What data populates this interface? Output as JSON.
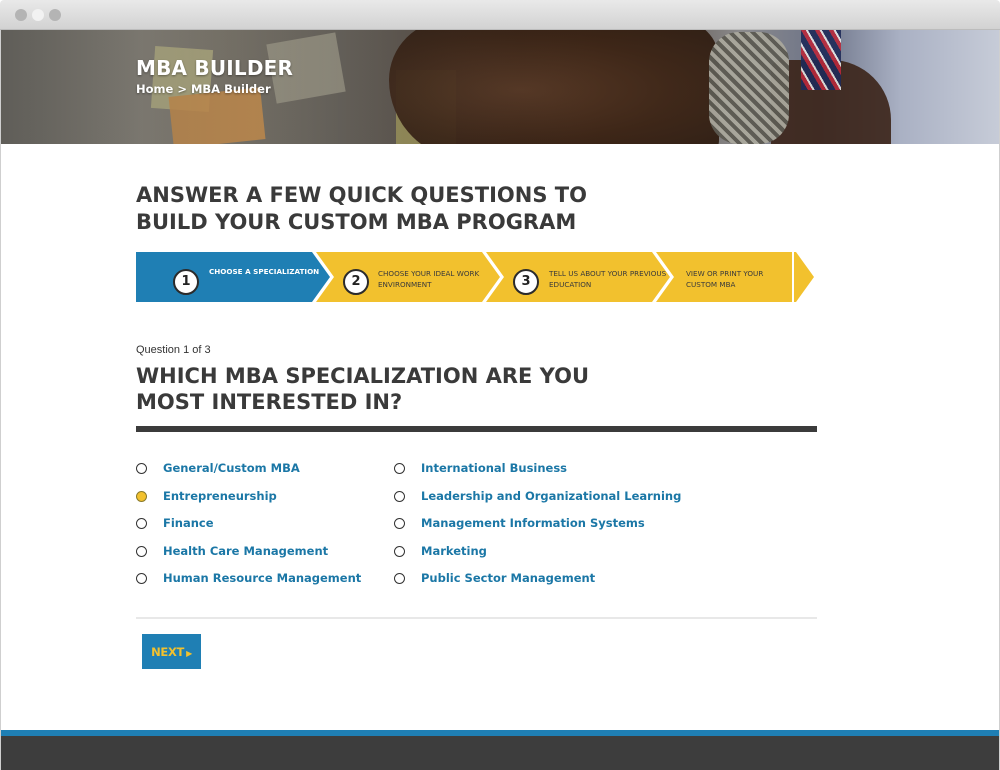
{
  "hero": {
    "title": "MBA BUILDER",
    "breadcrumb": {
      "home": "Home",
      "separator": " > ",
      "current": "MBA Builder"
    }
  },
  "main": {
    "heading": "ANSWER A FEW QUICK QUESTIONS TO BUILD YOUR CUSTOM MBA PROGRAM"
  },
  "steps": [
    {
      "number": "1",
      "label": "CHOOSE A SPECIALIZATION",
      "active": true
    },
    {
      "number": "2",
      "label": "CHOOSE YOUR IDEAL WORK ENVIRONMENT",
      "active": false
    },
    {
      "number": "3",
      "label": "TELL US ABOUT YOUR PREVIOUS EDUCATION",
      "active": false
    },
    {
      "number": "",
      "label": "VIEW OR PRINT YOUR CUSTOM MBA",
      "active": false
    }
  ],
  "question": {
    "count": "Question 1 of 3",
    "title": "WHICH MBA SPECIALIZATION ARE YOU MOST INTERESTED IN?"
  },
  "options": {
    "left": [
      {
        "label": "General/Custom MBA",
        "selected": false
      },
      {
        "label": "Entrepreneurship",
        "selected": true
      },
      {
        "label": "Finance",
        "selected": false
      },
      {
        "label": "Health Care Management",
        "selected": false
      },
      {
        "label": "Human Resource Management",
        "selected": false
      }
    ],
    "right": [
      {
        "label": "International Business",
        "selected": false
      },
      {
        "label": "Leadership and Organizational Learning",
        "selected": false
      },
      {
        "label": "Management Information Systems",
        "selected": false
      },
      {
        "label": "Marketing",
        "selected": false
      },
      {
        "label": "Public Sector Management",
        "selected": false
      }
    ]
  },
  "actions": {
    "next_label": "NEXT",
    "next_icon": "caret-right-icon"
  },
  "colors": {
    "primary_blue": "#1f7fb4",
    "accent_yellow": "#f2c12e",
    "heading_dark": "#3a3a3a",
    "footer_dark": "#3d3d3d"
  }
}
